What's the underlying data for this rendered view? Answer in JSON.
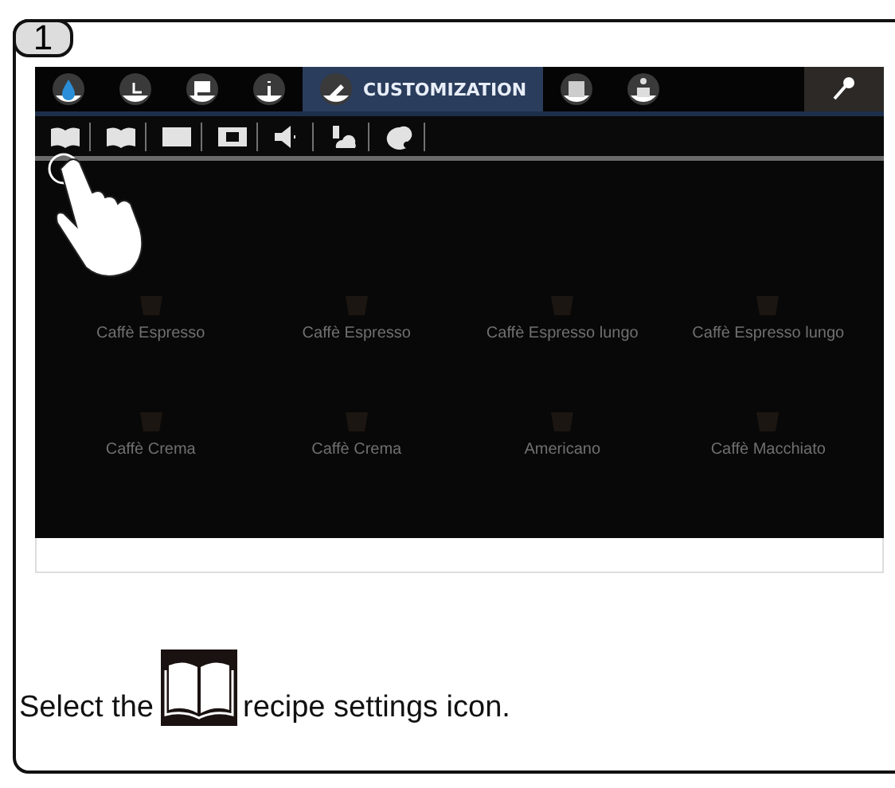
{
  "step": {
    "number": "1"
  },
  "screen": {
    "tabs": [
      {
        "kind": "icon",
        "selected": false
      },
      {
        "kind": "icon",
        "selected": false
      },
      {
        "kind": "icon",
        "selected": false
      },
      {
        "kind": "icon",
        "selected": false
      },
      {
        "kind": "label",
        "label": "CUSTOMIZATION",
        "selected": true
      },
      {
        "kind": "icon",
        "selected": false
      },
      {
        "kind": "icon",
        "selected": false
      }
    ],
    "products": [
      {
        "name": "Caffè Espresso"
      },
      {
        "name": "Caffè Espresso"
      },
      {
        "name": "Caffè Espresso lungo"
      },
      {
        "name": "Caffè Espresso lungo"
      },
      {
        "name": "Caffè Crema"
      },
      {
        "name": "Caffè Crema"
      },
      {
        "name": "Americano"
      },
      {
        "name": "Caffè Macchiato"
      }
    ]
  },
  "instruction": {
    "before": "Select the",
    "after": "recipe settings icon."
  }
}
